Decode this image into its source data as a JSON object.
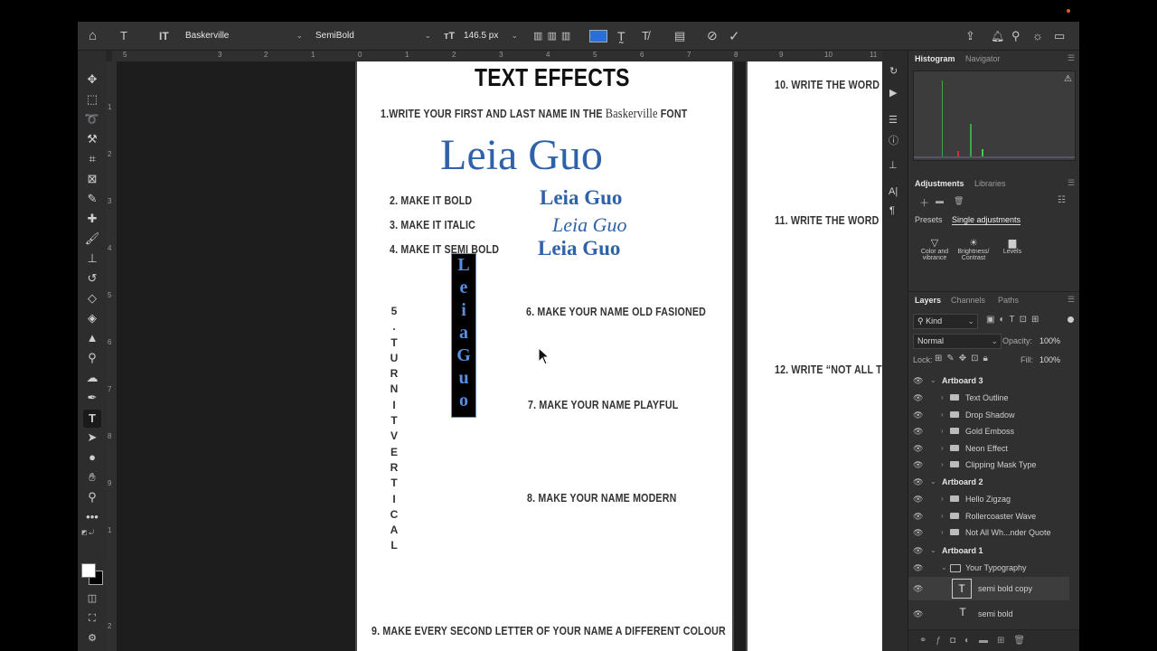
{
  "options": {
    "font_family": "Baskerville",
    "font_style": "SemiBold",
    "font_size": "146.5 px"
  },
  "ruler_h": [
    "5",
    "3",
    "2",
    "1",
    "0",
    "1",
    "2",
    "3",
    "4",
    "5",
    "6",
    "7",
    "8",
    "9",
    "10",
    "11"
  ],
  "ruler_v": [
    "1",
    "2",
    "3",
    "4",
    "5",
    "6",
    "7",
    "8",
    "9",
    "1",
    "2"
  ],
  "artboard1": {
    "title": "TEXT EFFECTS",
    "step1_prefix": "1.WRITE YOUR FIRST AND LAST NAME IN THE",
    "step1_font": "Baskerville",
    "step1_suffix": "FONT",
    "name_big": "Leia Guo",
    "step2": "2. MAKE IT BOLD",
    "step3": "3. MAKE IT ITALIC",
    "step4": "4. MAKE IT SEMI BOLD",
    "name_bold": "Leia Guo",
    "name_italic": "Leia Guo",
    "name_semibold": "Leia Guo",
    "step5_letters": [
      "5",
      ".",
      "T",
      "U",
      "R",
      "N",
      "I",
      "T",
      "V",
      "E",
      "R",
      "T",
      "I",
      "C",
      "A",
      "L"
    ],
    "vertical_letters": [
      "L",
      "e",
      "i",
      "a",
      "G",
      "u",
      "o"
    ],
    "step6": "6. MAKE YOUR NAME OLD FASIONED",
    "step7": "7. MAKE YOUR NAME PLAYFUL",
    "step8": "8. MAKE YOUR NAME MODERN",
    "step9": "9. MAKE EVERY SECOND LETTER OF YOUR NAME A DIFFERENT COLOUR"
  },
  "artboard2": {
    "step10": "10. WRITE THE WORD",
    "step11": "11. WRITE THE WORD",
    "step12": "12. WRITE “NOT ALL T"
  },
  "panels": {
    "histogram_tab": "Histogram",
    "navigator_tab": "Navigator",
    "adjustments_tab": "Adjustments",
    "libraries_tab": "Libraries",
    "presets_tab": "Presets",
    "single_adj_tab": "Single adjustments",
    "adj_items": [
      "Color and vibrance",
      "Brightness/ Contrast",
      "Levels"
    ],
    "layers_tab": "Layers",
    "channels_tab": "Channels",
    "paths_tab": "Paths",
    "filter_kind": "Kind",
    "blend_mode": "Normal",
    "opacity_label": "Opacity:",
    "opacity_value": "100%",
    "lock_label": "Lock:",
    "fill_label": "Fill:",
    "fill_value": "100%"
  },
  "layers": [
    {
      "name": "Artboard 3",
      "kind": "artboard"
    },
    {
      "name": "Text Outline",
      "kind": "group"
    },
    {
      "name": "Drop Shadow",
      "kind": "group"
    },
    {
      "name": "Gold Emboss",
      "kind": "group"
    },
    {
      "name": "Neon Effect",
      "kind": "group"
    },
    {
      "name": "Clipping Mask Type",
      "kind": "group"
    },
    {
      "name": "Artboard 2",
      "kind": "artboard"
    },
    {
      "name": "Hello Zigzag",
      "kind": "group"
    },
    {
      "name": "Rollercoaster Wave",
      "kind": "group"
    },
    {
      "name": "Not All Wh...nder Quote",
      "kind": "group"
    },
    {
      "name": "Artboard 1",
      "kind": "artboard"
    },
    {
      "name": "Your Typography",
      "kind": "group-open"
    },
    {
      "name": "semi bold copy",
      "kind": "text-selected"
    },
    {
      "name": "semi bold",
      "kind": "text"
    }
  ],
  "colors": {
    "name_blue": "#2f62a8",
    "vertical_blue": "#5b8ee0",
    "accent_swatch": "#2a6fd6"
  }
}
